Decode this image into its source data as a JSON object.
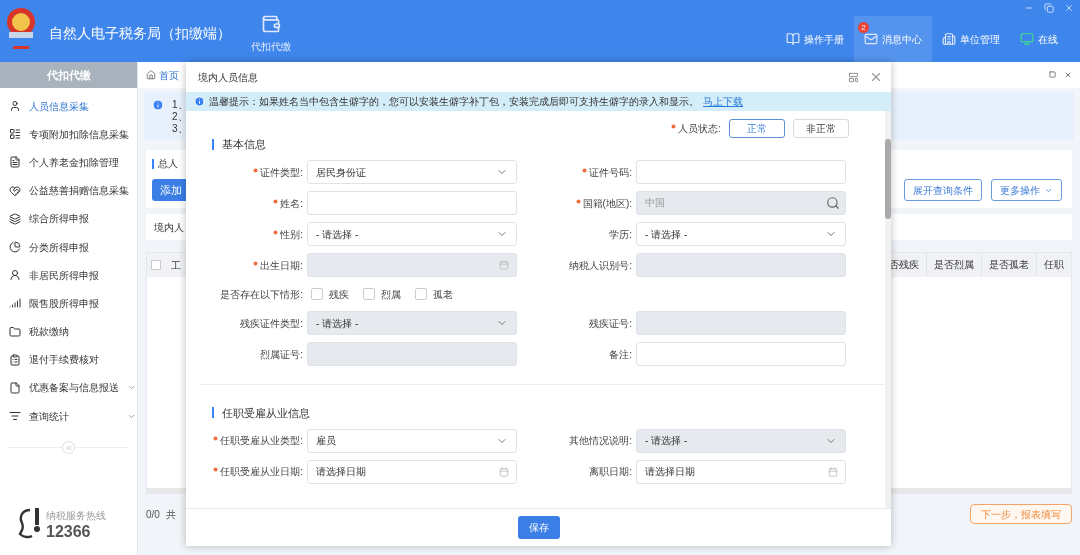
{
  "header": {
    "title": "自然人电子税务局（扣缴端）",
    "module": "代扣代缴",
    "nav": [
      {
        "label": "操作手册",
        "selected": false
      },
      {
        "label": "消息中心",
        "badge": "2",
        "selected": true
      },
      {
        "label": "单位管理",
        "selected": false
      },
      {
        "label": "在线",
        "selected": false
      }
    ]
  },
  "sidebar": {
    "title": "代扣代缴",
    "items": [
      {
        "label": "人员信息采集",
        "selected": true,
        "kind": "link"
      },
      {
        "label": "专项附加扣除信息采集",
        "selected": false,
        "kind": "link"
      },
      {
        "label": "个人养老金扣除管理",
        "selected": false,
        "kind": "link"
      },
      {
        "label": "公益慈善捐赠信息采集",
        "selected": false,
        "kind": "link"
      },
      {
        "label": "综合所得申报",
        "selected": false,
        "kind": "link"
      },
      {
        "label": "分类所得申报",
        "selected": false,
        "kind": "link"
      },
      {
        "label": "非居民所得申报",
        "selected": false,
        "kind": "link"
      },
      {
        "label": "限售股所得申报",
        "selected": false,
        "kind": "link"
      },
      {
        "label": "税款缴纳",
        "selected": false,
        "kind": "link"
      },
      {
        "label": "退付手续费核对",
        "selected": false,
        "kind": "link"
      },
      {
        "label": "优惠备案与信息报送",
        "selected": false,
        "kind": "group"
      },
      {
        "label": "查询统计",
        "selected": false,
        "kind": "group"
      }
    ],
    "hotline": {
      "label": "纳税服务热线",
      "number": "12366"
    }
  },
  "main": {
    "breadcrumb": "首页",
    "info_lines": [
      "1、",
      "2、",
      "3、"
    ],
    "summary": "总人",
    "add_button": "添加",
    "buttons": [
      "展开查询条件",
      "更多操作"
    ],
    "tab": "境内人",
    "table": {
      "select_all": {
        "checked": false
      },
      "columns": [
        "工",
        "否残疾",
        "是否烈属",
        "是否孤老",
        "任职"
      ]
    },
    "pager": "0/0",
    "pager_total": "共",
    "next_button": "下一步，报表填写"
  },
  "dialog": {
    "title": "境内人员信息",
    "notice": {
      "text": "温馨提示：如果姓名当中包含生僻字的，您可以安装生僻字补丁包，安装完成后即可支持生僻字的录入和显示。",
      "link": "马上下载"
    },
    "status": {
      "label": "人员状态:",
      "required": true,
      "options": [
        {
          "label": "正常",
          "selected": true
        },
        {
          "label": "非正常",
          "selected": false
        }
      ]
    },
    "sections": [
      {
        "title": "基本信息",
        "fields": [
          {
            "label": "证件类型:",
            "kind": "select",
            "value": "居民身份证",
            "required": true,
            "disabled": false
          },
          {
            "label": "证件号码:",
            "kind": "input",
            "required": true,
            "disabled": false
          },
          {
            "label": "姓名:",
            "kind": "input",
            "required": true,
            "disabled": false
          },
          {
            "label": "国籍(地区):",
            "kind": "search",
            "value": "中国",
            "required": true,
            "disabled": true
          },
          {
            "label": "性别:",
            "kind": "select",
            "value": "- 请选择 -",
            "required": true,
            "disabled": false
          },
          {
            "label": "学历:",
            "kind": "select",
            "value": "- 请选择 -",
            "required": false,
            "disabled": false
          },
          {
            "label": "出生日期:",
            "kind": "date",
            "required": true,
            "disabled": true
          },
          {
            "label": "纳税人识别号:",
            "kind": "input",
            "required": false,
            "disabled": true
          },
          {
            "label": "是否存在以下情形:",
            "kind": "checks",
            "options": [
              {
                "label": "残疾",
                "checked": false
              },
              {
                "label": "烈属",
                "checked": false
              },
              {
                "label": "孤老",
                "checked": false
              }
            ]
          },
          {
            "label": "残疾证件类型:",
            "kind": "select",
            "value": "- 请选择 -",
            "required": false,
            "disabled": true
          },
          {
            "label": "残疾证号:",
            "kind": "input",
            "required": false,
            "disabled": true
          },
          {
            "label": "烈属证号:",
            "kind": "input",
            "required": false,
            "disabled": true
          },
          {
            "label": "备注:",
            "kind": "input",
            "required": false,
            "disabled": false
          }
        ]
      },
      {
        "title": "任职受雇从业信息",
        "fields": [
          {
            "label": "任职受雇从业类型:",
            "kind": "select",
            "value": "雇员",
            "required": true,
            "disabled": false
          },
          {
            "label": "其他情况说明:",
            "kind": "select",
            "value": "- 请选择 -",
            "required": false,
            "disabled": true
          },
          {
            "label": "任职受雇从业日期:",
            "kind": "date",
            "placeholder": "请选择日期",
            "required": true,
            "disabled": false
          },
          {
            "label": "离职日期:",
            "kind": "date",
            "placeholder": "请选择日期",
            "required": false,
            "disabled": false
          }
        ]
      }
    ],
    "save_button": "保存"
  }
}
